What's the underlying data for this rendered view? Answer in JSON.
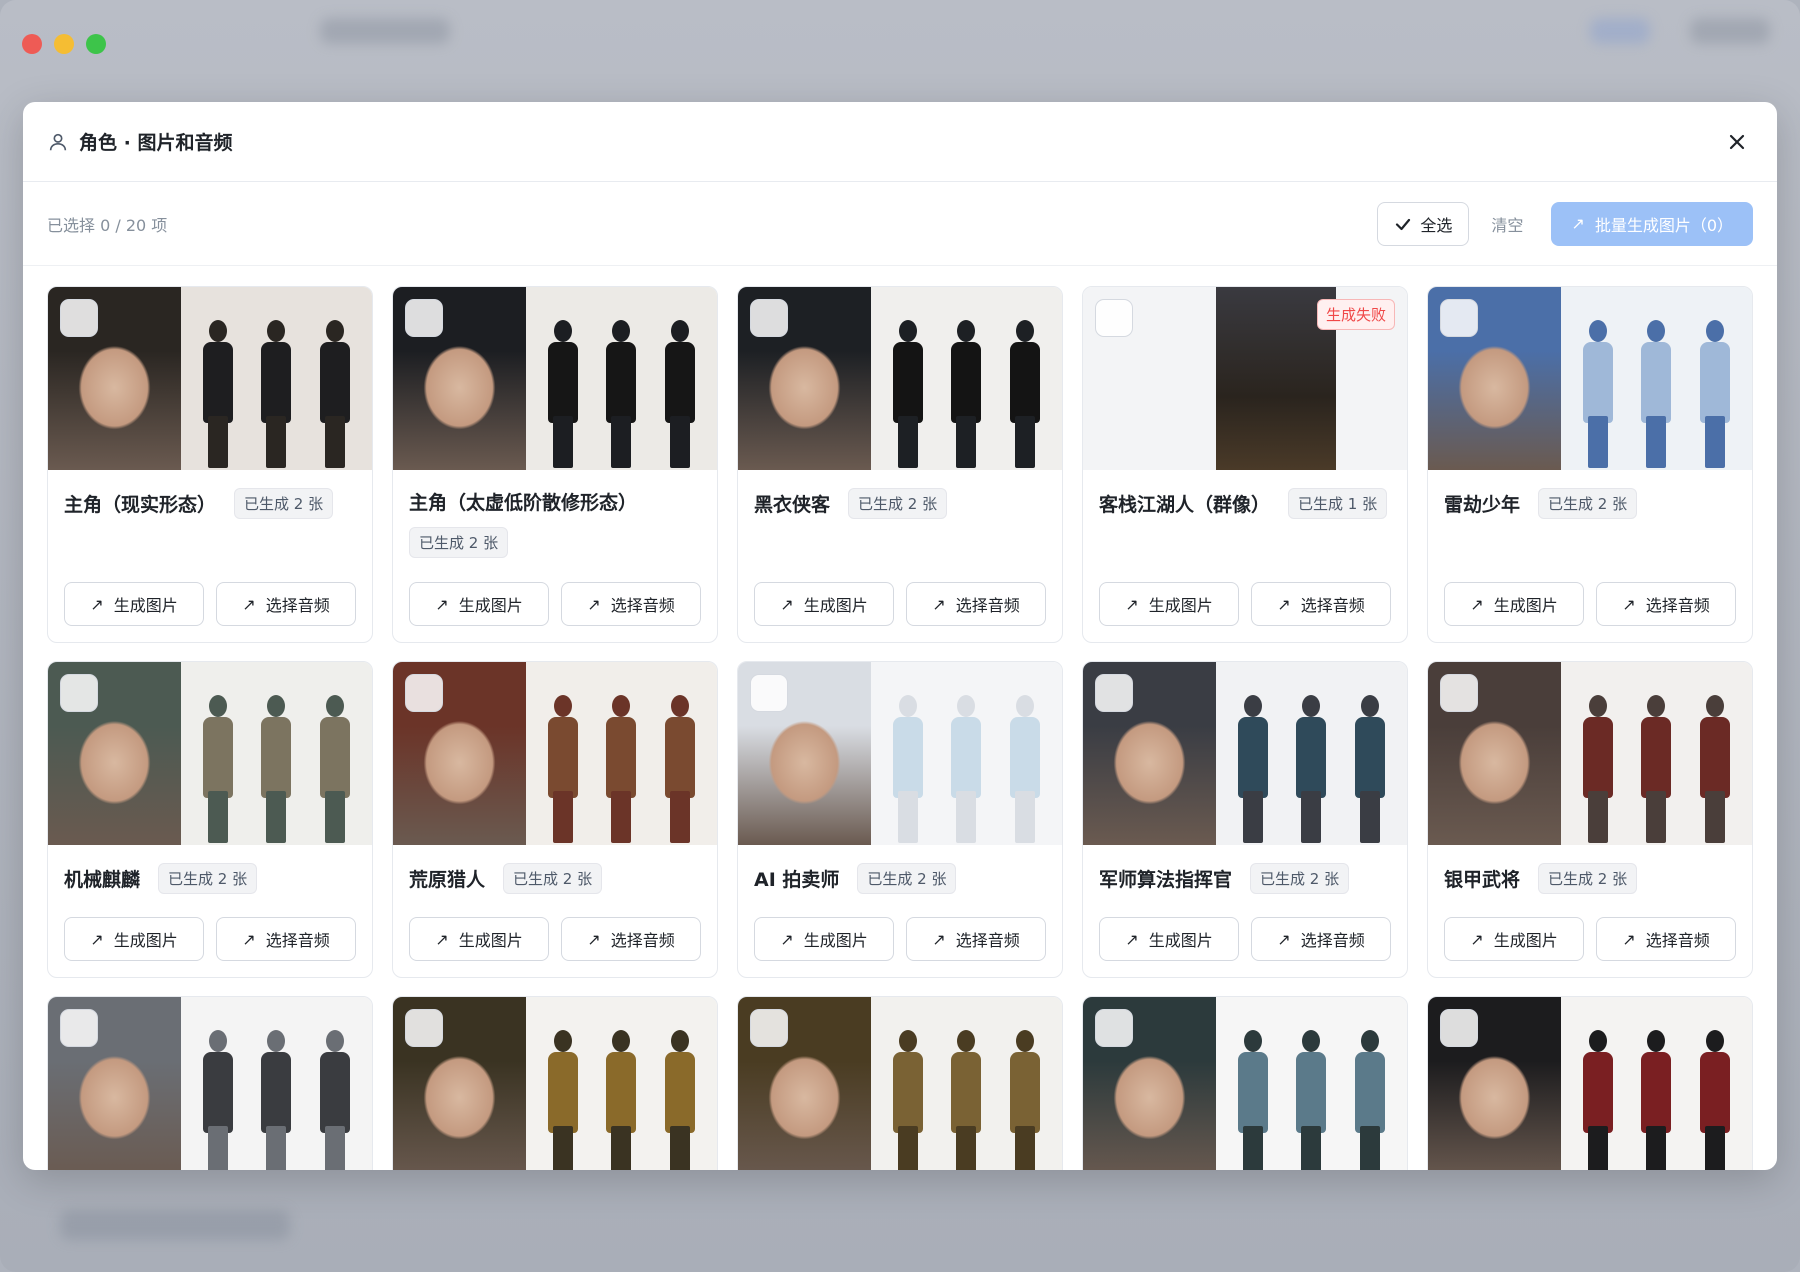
{
  "header": {
    "title": "角色 · 图片和音频"
  },
  "toolbar": {
    "selection_text": "已选择 0 / 20 项",
    "select_all_label": "全选",
    "clear_label": "清空",
    "batch_label": "批量生成图片（0）"
  },
  "card_actions": {
    "generate_image": "生成图片",
    "select_audio": "选择音频"
  },
  "characters": [
    {
      "name": "主角（现实形态）",
      "badge": "已生成 2 张",
      "palette": [
        "#2a2622",
        "#e7e2dd",
        "#1e1e20"
      ]
    },
    {
      "name": "主角（太虚低阶散修形态）",
      "badge": "已生成 2 张",
      "palette": [
        "#1c1e22",
        "#eceae6",
        "#161616"
      ]
    },
    {
      "name": "黑衣侠客",
      "badge": "已生成 2 张",
      "palette": [
        "#1d2024",
        "#f0efed",
        "#141414"
      ]
    },
    {
      "name": "客栈江湖人（群像）",
      "badge": "已生成 1 张",
      "fail": "生成失败",
      "palette": [
        "#2b2520",
        "#f3f4f6",
        "#3a2f24"
      ]
    },
    {
      "name": "雷劫少年",
      "badge": "已生成 2 张",
      "palette": [
        "#4b6fa8",
        "#eef2f6",
        "#9fb8d8"
      ]
    },
    {
      "name": "机械麒麟",
      "badge": "已生成 2 张",
      "palette": [
        "#4c5a52",
        "#efefec",
        "#7c7460"
      ]
    },
    {
      "name": "荒原猎人",
      "badge": "已生成 2 张",
      "palette": [
        "#6b3428",
        "#f1eeea",
        "#7a4a30"
      ]
    },
    {
      "name": "AI 拍卖师",
      "badge": "已生成 2 张",
      "palette": [
        "#d9dde3",
        "#f4f5f7",
        "#c9dbe8"
      ]
    },
    {
      "name": "军师算法指挥官",
      "badge": "已生成 2 张",
      "palette": [
        "#3a3d44",
        "#f1f2f4",
        "#2f4a5a"
      ]
    },
    {
      "name": "银甲武将",
      "badge": "已生成 2 张",
      "palette": [
        "#4a3e3a",
        "#f2f0ee",
        "#6b2a25"
      ]
    },
    {
      "name": "",
      "badge": "",
      "palette": [
        "#6a6e74",
        "#f4f4f4",
        "#3a3c40"
      ]
    },
    {
      "name": "",
      "badge": "",
      "palette": [
        "#3a3322",
        "#f3f2ef",
        "#8a6a2a"
      ]
    },
    {
      "name": "",
      "badge": "",
      "palette": [
        "#4a3c22",
        "#f2f1ee",
        "#7a6234"
      ]
    },
    {
      "name": "",
      "badge": "",
      "palette": [
        "#2c3a3c",
        "#f6f6f6",
        "#5b7a8a"
      ]
    },
    {
      "name": "",
      "badge": "",
      "palette": [
        "#1c1c1e",
        "#f4f3f2",
        "#7a1f22"
      ]
    }
  ]
}
